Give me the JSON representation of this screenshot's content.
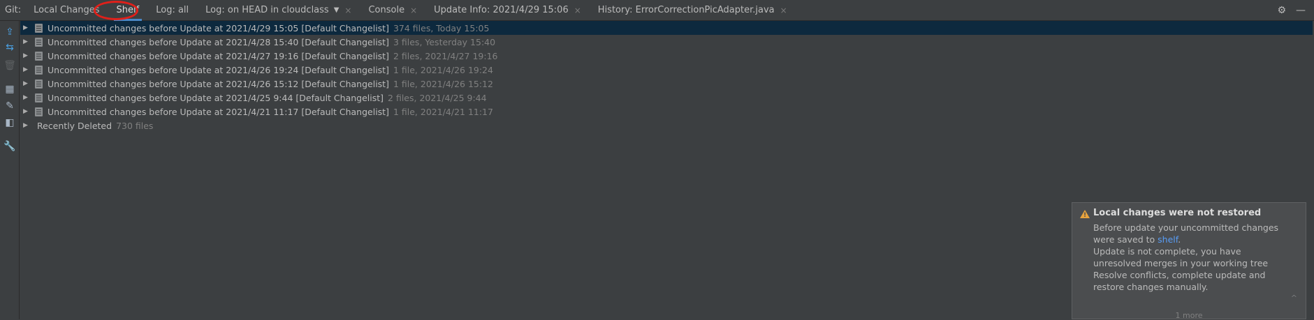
{
  "toolbar": {
    "git_label": "Git:",
    "tabs": [
      {
        "label": "Local Changes",
        "closable": false
      },
      {
        "label": "Shelf",
        "closable": false,
        "active": true
      },
      {
        "label": "Log: all",
        "closable": false
      },
      {
        "label": "Log: on HEAD in cloudclass",
        "closable": true,
        "dropdown": true
      },
      {
        "label": "Console",
        "closable": true
      },
      {
        "label": "Update Info: 2021/4/29 15:06",
        "closable": true
      },
      {
        "label": "History: ErrorCorrectionPicAdapter.java",
        "closable": true
      }
    ],
    "close_glyph": "×",
    "dropdown_glyph": "▼",
    "settings_icon": "⚙",
    "minimize_icon": "—"
  },
  "left_tools": [
    {
      "name": "unshelve-icon",
      "glyph": "⇪"
    },
    {
      "name": "merge-icon",
      "glyph": "⇆"
    },
    {
      "name": "delete-icon",
      "glyph": "🗑"
    },
    {
      "name": "group-by-icon",
      "glyph": "▦"
    },
    {
      "name": "cleanup-icon",
      "glyph": "✎"
    },
    {
      "name": "preview-icon",
      "glyph": "◧"
    },
    {
      "name": "settings-wrench-icon",
      "glyph": "🔧"
    }
  ],
  "shelf": {
    "items": [
      {
        "label": "Uncommitted changes before Update at 2021/4/29 15:05 [Default Changelist]",
        "info": "374 files, Today 15:05"
      },
      {
        "label": "Uncommitted changes before Update at 2021/4/28 15:40 [Default Changelist]",
        "info": "3 files, Yesterday 15:40"
      },
      {
        "label": "Uncommitted changes before Update at 2021/4/27 19:16 [Default Changelist]",
        "info": "2 files, 2021/4/27 19:16"
      },
      {
        "label": "Uncommitted changes before Update at 2021/4/26 19:24 [Default Changelist]",
        "info": "1 file, 2021/4/26 19:24"
      },
      {
        "label": "Uncommitted changes before Update at 2021/4/26 15:12 [Default Changelist]",
        "info": "1 file, 2021/4/26 15:12"
      },
      {
        "label": "Uncommitted changes before Update at 2021/4/25 9:44 [Default Changelist]",
        "info": "2 files, 2021/4/25 9:44"
      },
      {
        "label": "Uncommitted changes before Update at 2021/4/21 11:17 [Default Changelist]",
        "info": "1 file, 2021/4/21 11:17"
      }
    ],
    "recently_deleted": {
      "label": "Recently Deleted",
      "info": "730 files"
    },
    "expand_glyph": "▶"
  },
  "notification": {
    "title": "Local changes were not restored",
    "warn_glyph": "!",
    "line1": "Before update your uncommitted changes",
    "line2_prefix": "were saved to ",
    "line2_link": "shelf",
    "line2_suffix": ".",
    "line3": "Update is not complete, you have",
    "line4": "unresolved merges in your working tree",
    "line5": "Resolve conflicts, complete update and",
    "line6": "restore changes manually.",
    "chevron": "^",
    "more": "1 more"
  },
  "colors": {
    "background": "#3c3f41",
    "selection": "#0d293e",
    "accent": "#4a88c7",
    "link": "#589df6",
    "warning": "#e8a33d",
    "highlight_ring": "#e0201a"
  }
}
